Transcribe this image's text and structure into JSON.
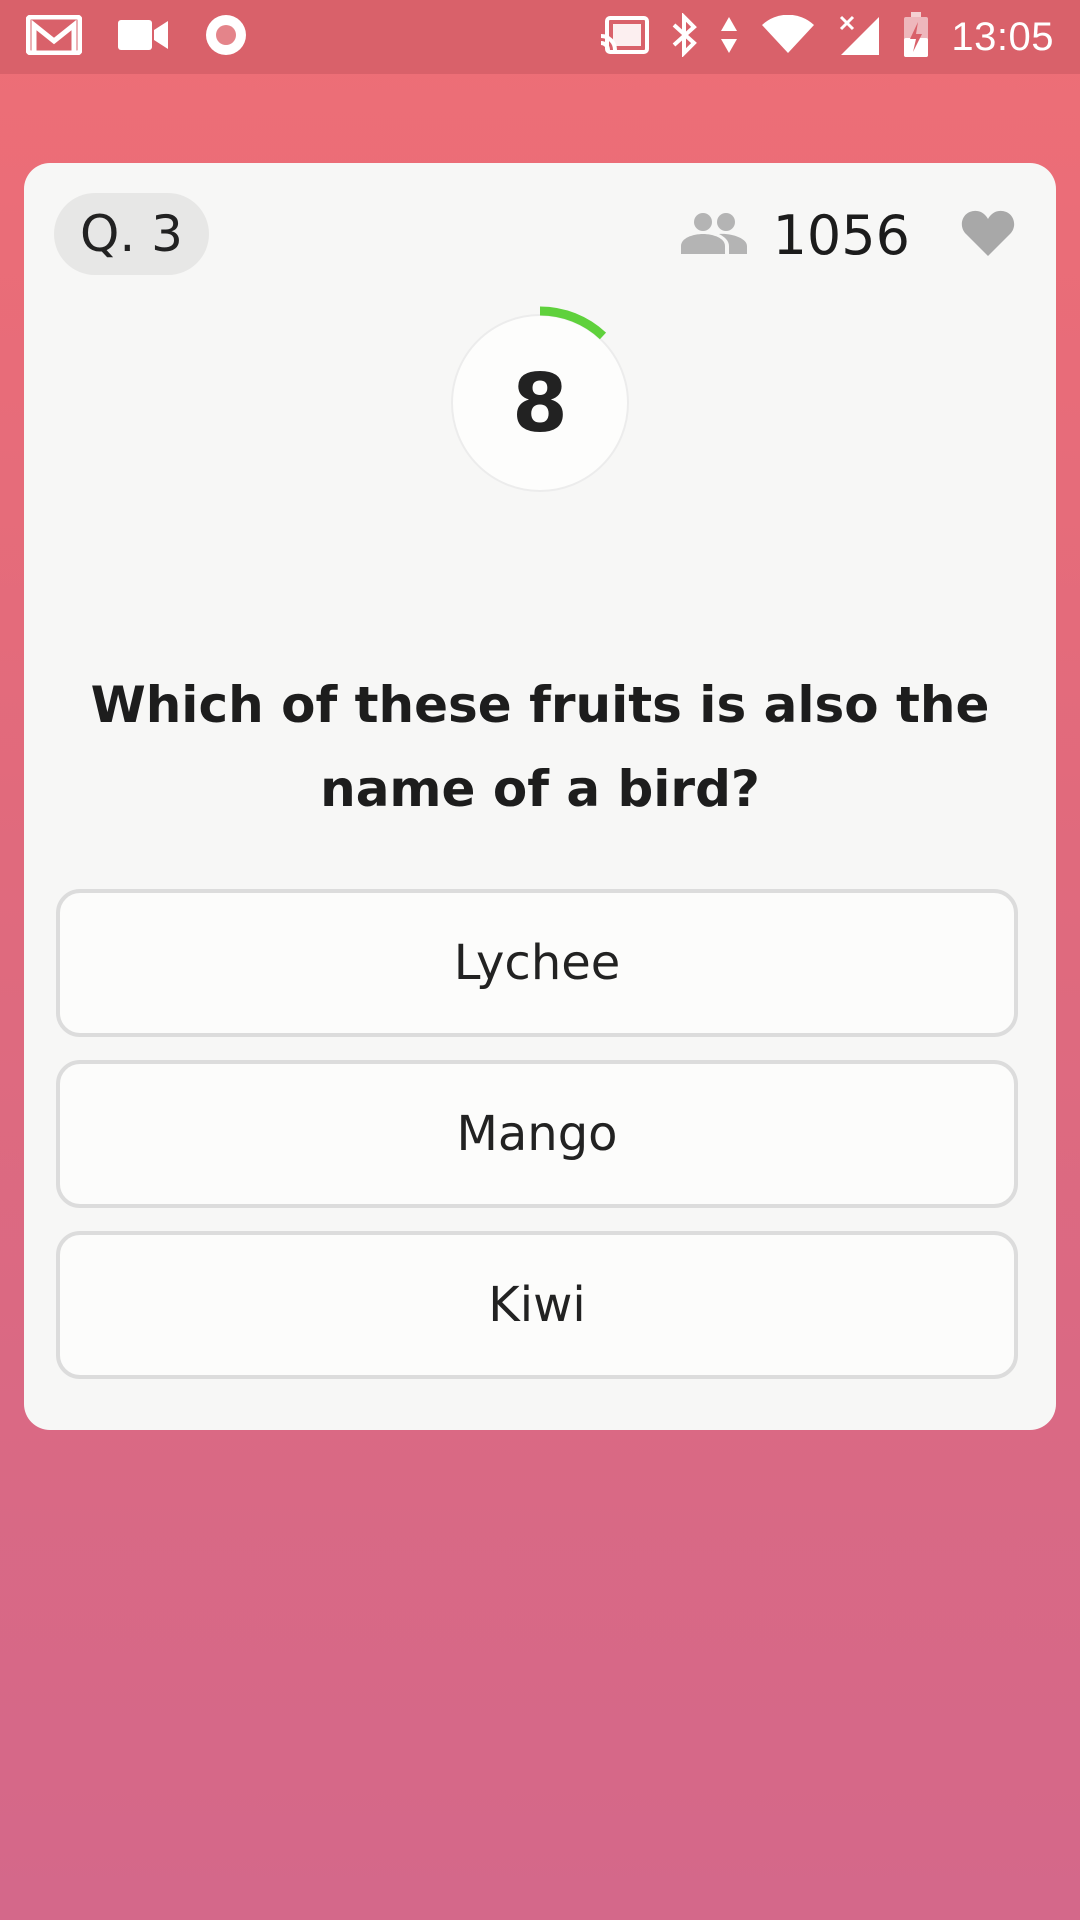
{
  "status_bar": {
    "time": "13:05",
    "left_icons": [
      "gmail-icon",
      "video-camera-icon",
      "record-icon"
    ],
    "right_icons": [
      "cast-icon",
      "bluetooth-icon",
      "data-arrows-icon",
      "wifi-icon",
      "signal-icon",
      "battery-charging-icon"
    ]
  },
  "quiz": {
    "question_badge": "Q. 3",
    "viewer_count": "1056",
    "timer_value": "8",
    "timer_progress": 0.12,
    "question": "Which of these fruits is also the name of a bird?",
    "options": [
      "Lychee",
      "Mango",
      "Kiwi"
    ]
  },
  "colors": {
    "accent_timer": "#5fd13c",
    "background_top": "#ee6e76",
    "background_bottom": "#d4688a"
  }
}
